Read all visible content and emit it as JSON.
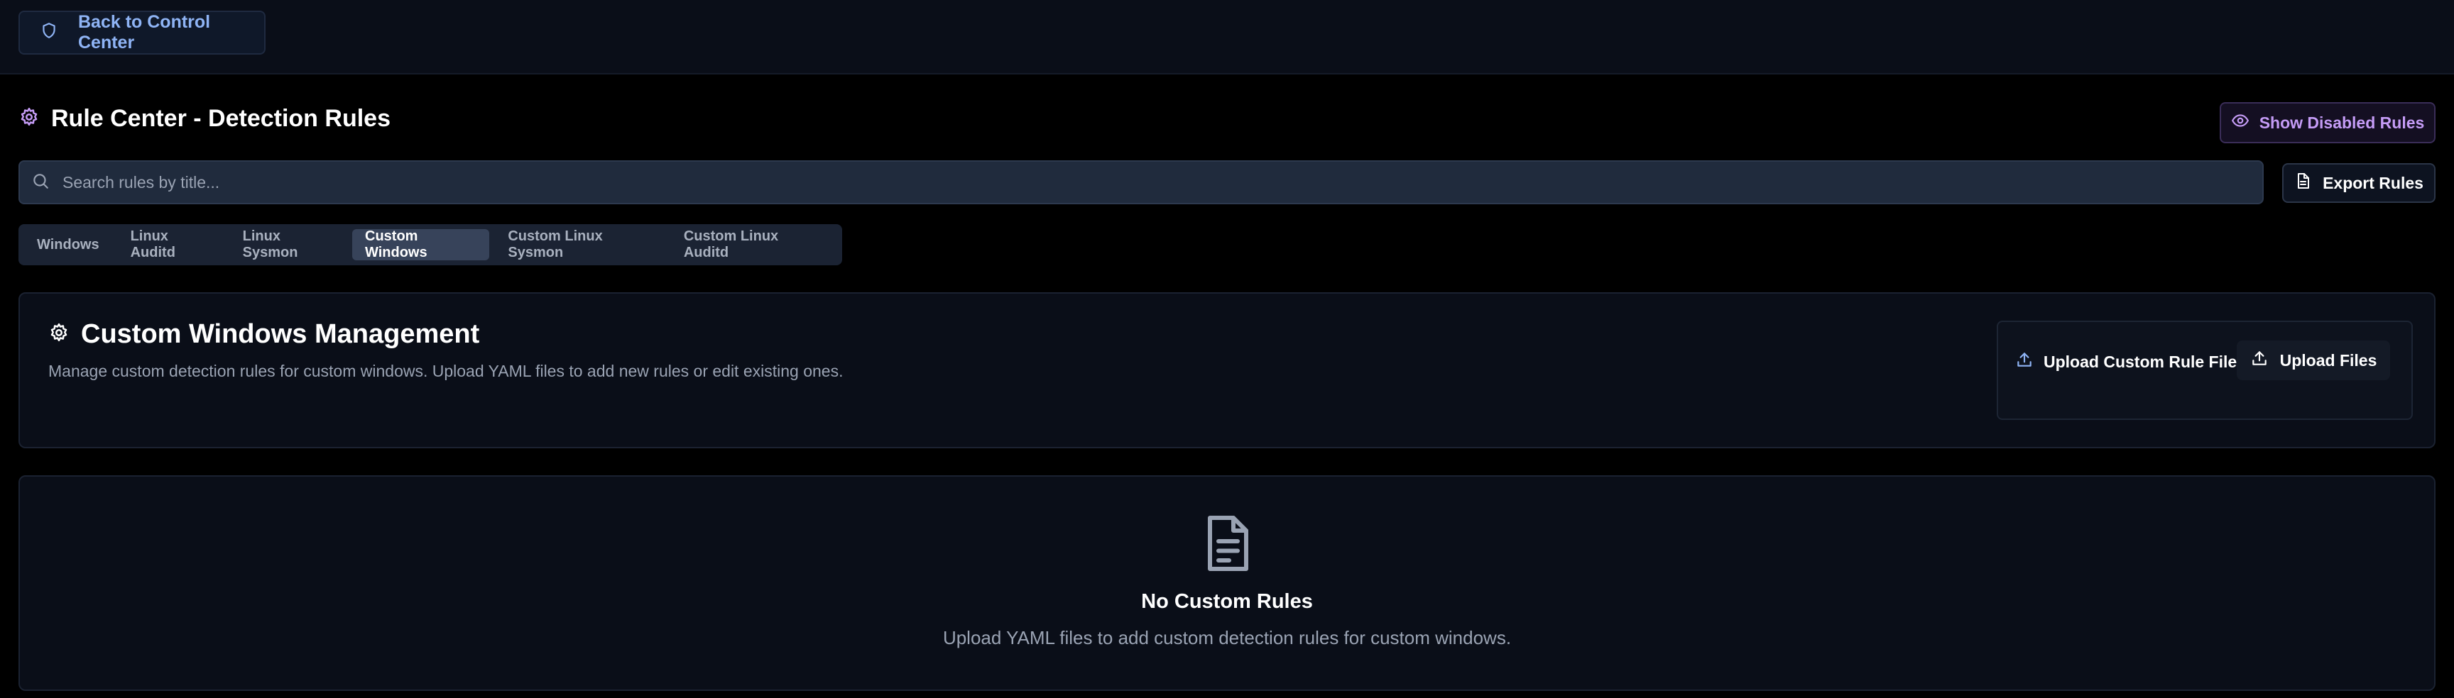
{
  "header": {
    "back_label": "Back to Control Center"
  },
  "page": {
    "title": "Rule Center - Detection Rules",
    "show_disabled_label": "Show Disabled Rules",
    "export_label": "Export Rules"
  },
  "search": {
    "placeholder": "Search rules by title...",
    "value": ""
  },
  "tabs": [
    {
      "label": "Windows",
      "active": false
    },
    {
      "label": "Linux Auditd",
      "active": false
    },
    {
      "label": "Linux Sysmon",
      "active": false
    },
    {
      "label": "Custom Windows",
      "active": true
    },
    {
      "label": "Custom Linux Sysmon",
      "active": false
    },
    {
      "label": "Custom Linux Auditd",
      "active": false
    }
  ],
  "management": {
    "title": "Custom Windows Management",
    "description": "Manage custom detection rules for custom windows. Upload YAML files to add new rules or edit existing ones.",
    "upload_label": "Upload Custom Rule Files",
    "upload_button": "Upload Files"
  },
  "empty_state": {
    "title": "No Custom Rules",
    "description": "Upload YAML files to add custom detection rules for custom windows."
  },
  "colors": {
    "accent_purple": "#c59cf6",
    "accent_blue": "#8fb4f5",
    "background": "#000000",
    "card": "#0a0e18"
  },
  "icons": {
    "back": "shield-icon",
    "title": "gear-icon",
    "show_disabled": "eye-icon",
    "search": "search-icon",
    "export": "file-text-icon",
    "upload": "upload-icon",
    "empty": "file-text-icon"
  }
}
